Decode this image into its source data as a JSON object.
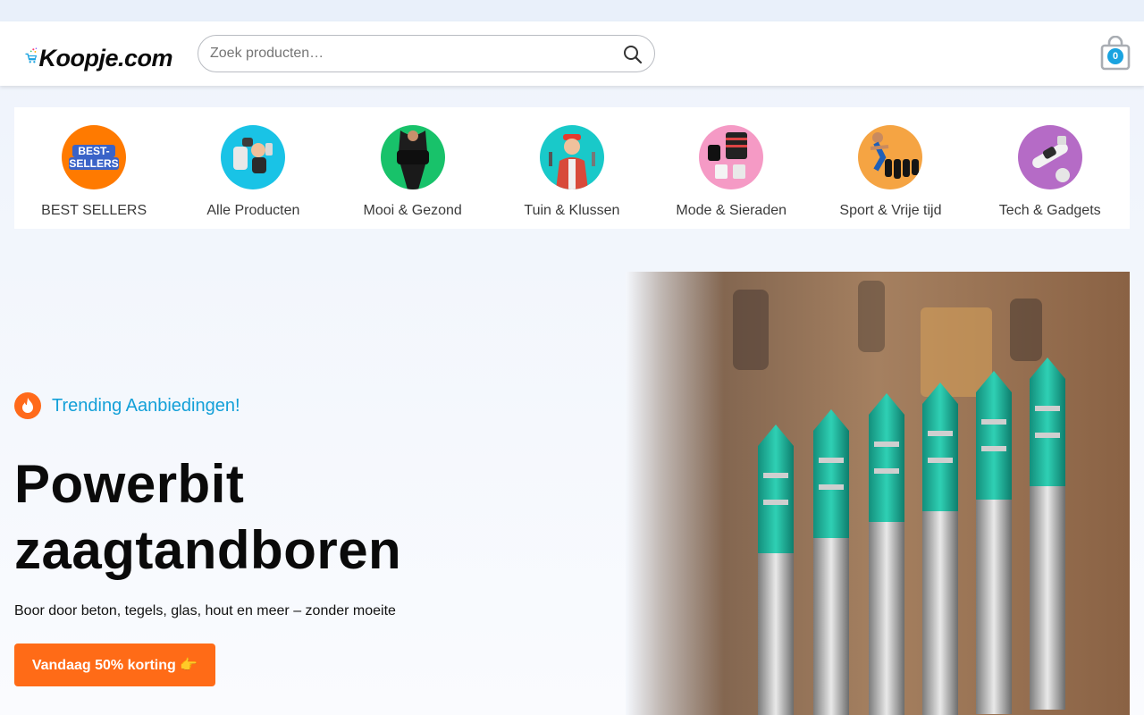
{
  "header": {
    "logo_text": "Koopje.com",
    "search": {
      "placeholder": "Zoek producten…",
      "value": ""
    },
    "cart": {
      "count": "0"
    }
  },
  "categories": [
    {
      "label": "BEST SELLERS",
      "icon": "best-sellers-badge",
      "bg": "#ff7a00",
      "badge_text": "BEST-SELLERS"
    },
    {
      "label": "Alle Producten",
      "icon": "product-collage",
      "bg": "#19c3e6"
    },
    {
      "label": "Mooi & Gezond",
      "icon": "waist-trainer",
      "bg": "#18c26a"
    },
    {
      "label": "Tuin & Klussen",
      "icon": "handyman",
      "bg": "#19c9c9"
    },
    {
      "label": "Mode & Sieraden",
      "icon": "fashion-items",
      "bg": "#f59ac5"
    },
    {
      "label": "Sport & Vrije tijd",
      "icon": "runner-socks",
      "bg": "#f5a443"
    },
    {
      "label": "Tech & Gadgets",
      "icon": "gadget",
      "bg": "#b56bc6"
    }
  ],
  "hero": {
    "tag": "Trending Aanbiedingen!",
    "title": "Powerbit zaagtandboren",
    "subtitle": "Boor door beton, tegels, glas, hout en meer – zonder moeite",
    "cta_label": "Vandaag 50% korting 👉",
    "image": "teal-drill-bits"
  },
  "colors": {
    "accent_orange": "#ff6b17",
    "accent_blue": "#13a0d8",
    "drill_teal": "#1fb39a"
  }
}
